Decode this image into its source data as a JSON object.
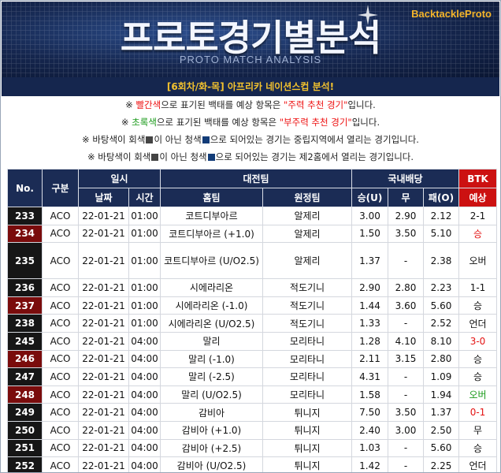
{
  "banner": {
    "title": "프로토경기별분석",
    "subtitle": "PROTO MATCH ANALYSIS",
    "brand": "BacktackleProto"
  },
  "round_title": "[6회차/화-목] 아프리카 네이션스컵 분석!",
  "notes": {
    "line1": {
      "pre": "※ ",
      "color_word": "빨간색",
      "mid": "으로 표기된 백태를 예상 항목은 ",
      "quote": "\"주력 추천 경기\"",
      "post": "입니다."
    },
    "line2": {
      "pre": "※ ",
      "color_word": "초록색",
      "mid": "으로 표기된 백태를 예상 항목은 ",
      "quote": "\"부주력 추천 경기\"",
      "post": "입니다."
    },
    "line3": {
      "a": "※ 바탕색이 회색",
      "b": "이 아닌 청색",
      "c": "으로 되어있는 경기는 중립지역에서 열리는 경기입니다."
    },
    "line4": {
      "a": "※ 바탕색이 회색",
      "b": "이 아닌 청색",
      "c": "으로 되어있는 경기는 제2홈에서 열리는 경기입니다."
    }
  },
  "table": {
    "headers": {
      "no": "No.",
      "category": "구분",
      "datetime": "일시",
      "matchup": "대전팀",
      "odds": "국내배당",
      "btk": "BTK",
      "date": "날짜",
      "time": "시간",
      "home": "홈팀",
      "away": "원정팀",
      "win": "승(U)",
      "draw": "무",
      "lose": "패(O)",
      "pred": "예상"
    },
    "rows": [
      {
        "no": "233",
        "cat": "ACO",
        "date": "22-01-21",
        "time": "01:00",
        "home": "코트디부아르",
        "away": "알제리",
        "w": "3.00",
        "d": "2.90",
        "l": "2.12",
        "pred": "2-1"
      },
      {
        "no": "234",
        "cat": "ACO",
        "date": "22-01-21",
        "time": "01:00",
        "home": "코트디부아르 (+1.0)",
        "away": "알제리",
        "w": "1.50",
        "d": "3.50",
        "l": "5.10",
        "pred": "승"
      },
      {
        "no": "235",
        "cat": "ACO",
        "date": "22-01-21",
        "time": "01:00",
        "home": "코트디부아르 (U/O2.5)",
        "away": "알제리",
        "w": "1.37",
        "d": "-",
        "l": "2.38",
        "pred": "오버"
      },
      {
        "no": "236",
        "cat": "ACO",
        "date": "22-01-21",
        "time": "01:00",
        "home": "시에라리온",
        "away": "적도기니",
        "w": "2.90",
        "d": "2.80",
        "l": "2.23",
        "pred": "1-1"
      },
      {
        "no": "237",
        "cat": "ACO",
        "date": "22-01-21",
        "time": "01:00",
        "home": "시에라리온 (-1.0)",
        "away": "적도기니",
        "w": "1.44",
        "d": "3.60",
        "l": "5.60",
        "pred": "승"
      },
      {
        "no": "238",
        "cat": "ACO",
        "date": "22-01-21",
        "time": "01:00",
        "home": "시에라리온 (U/O2.5)",
        "away": "적도기니",
        "w": "1.33",
        "d": "-",
        "l": "2.52",
        "pred": "언더"
      },
      {
        "no": "245",
        "cat": "ACO",
        "date": "22-01-21",
        "time": "04:00",
        "home": "말리",
        "away": "모리타니",
        "w": "1.28",
        "d": "4.10",
        "l": "8.10",
        "pred": "3-0"
      },
      {
        "no": "246",
        "cat": "ACO",
        "date": "22-01-21",
        "time": "04:00",
        "home": "말리 (-1.0)",
        "away": "모리타니",
        "w": "2.11",
        "d": "3.15",
        "l": "2.80",
        "pred": "승"
      },
      {
        "no": "247",
        "cat": "ACO",
        "date": "22-01-21",
        "time": "04:00",
        "home": "말리 (-2.5)",
        "away": "모리타니",
        "w": "4.31",
        "d": "-",
        "l": "1.09",
        "pred": "승"
      },
      {
        "no": "248",
        "cat": "ACO",
        "date": "22-01-21",
        "time": "04:00",
        "home": "말리 (U/O2.5)",
        "away": "모리타니",
        "w": "1.58",
        "d": "-",
        "l": "1.94",
        "pred": "오버"
      },
      {
        "no": "249",
        "cat": "ACO",
        "date": "22-01-21",
        "time": "04:00",
        "home": "감비아",
        "away": "튀니지",
        "w": "7.50",
        "d": "3.50",
        "l": "1.37",
        "pred": "0-1"
      },
      {
        "no": "250",
        "cat": "ACO",
        "date": "22-01-21",
        "time": "04:00",
        "home": "감비아 (+1.0)",
        "away": "튀니지",
        "w": "2.40",
        "d": "3.00",
        "l": "2.50",
        "pred": "무"
      },
      {
        "no": "251",
        "cat": "ACO",
        "date": "22-01-21",
        "time": "04:00",
        "home": "감비아 (+2.5)",
        "away": "튀니지",
        "w": "1.03",
        "d": "-",
        "l": "5.60",
        "pred": "승"
      },
      {
        "no": "252",
        "cat": "ACO",
        "date": "22-01-21",
        "time": "04:00",
        "home": "감비아 (U/O2.5)",
        "away": "튀니지",
        "w": "1.42",
        "d": "-",
        "l": "2.25",
        "pred": "언더"
      }
    ],
    "styles": {
      "red_number_rows": [
        "234",
        "237",
        "246",
        "248"
      ],
      "red_pick_rows": [
        "234",
        "245",
        "249"
      ],
      "green_pick_rows": [
        "248"
      ],
      "colors": {
        "header_bg": "#1b2c55",
        "btk_bg": "#cc1111",
        "red": "#e41414",
        "green": "#1a9a1a",
        "gold": "#f3c22e"
      }
    }
  }
}
